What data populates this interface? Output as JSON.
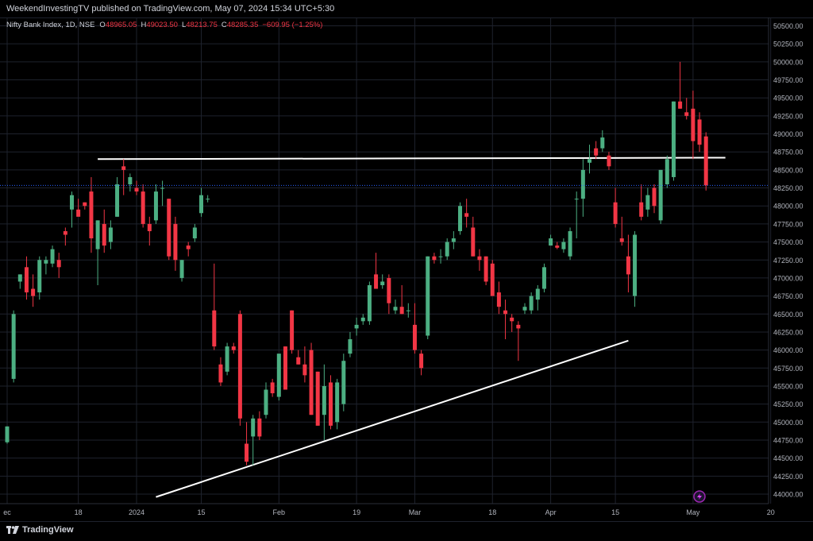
{
  "header": {
    "published": "WeekendInvestingTV published on TradingView.com, May 07, 2024 15:34 UTC+5:30"
  },
  "legend": {
    "symbol": "Nifty Bank Index, 1D, NSE",
    "o_label": "O",
    "o": "48965.05",
    "h_label": "H",
    "h": "49023.50",
    "l_label": "L",
    "l": "48213.75",
    "c_label": "C",
    "c": "48285.35",
    "change": "−609.95 (−1.25%)"
  },
  "footer": {
    "brand": "TradingView"
  },
  "colors": {
    "up": "#4caf82",
    "down": "#f23645",
    "grid": "#1e222d",
    "axis_text": "#b2b5be",
    "trendline": "#ffffff",
    "price_line": "#2962ff"
  },
  "chart_data": {
    "type": "candlestick",
    "symbol": "Nifty Bank Index",
    "interval": "1D",
    "exchange": "NSE",
    "ylim": [
      43950,
      50750
    ],
    "yticks": [
      44000,
      44250,
      44500,
      44750,
      45000,
      45250,
      45500,
      45750,
      46000,
      46250,
      46500,
      46750,
      47000,
      47250,
      47500,
      47750,
      48000,
      48250,
      48500,
      48750,
      49000,
      49250,
      49500,
      49750,
      50000,
      50250,
      50500
    ],
    "ytick_labels": [
      "44000.00",
      "44250.00",
      "44500.00",
      "44750.00",
      "45000.00",
      "45250.00",
      "45500.00",
      "45750.00",
      "46000.00",
      "46250.00",
      "46500.00",
      "46750.00",
      "47000.00",
      "47250.00",
      "47500.00",
      "47750.00",
      "48000.00",
      "48250.00",
      "48500.00",
      "48750.00",
      "49000.00",
      "49250.00",
      "49500.00",
      "49750.00",
      "50000.00",
      "50250.00",
      "50500.00"
    ],
    "xticks": [
      {
        "label": "ec",
        "index": 0
      },
      {
        "label": "18",
        "index": 11
      },
      {
        "label": "2024",
        "index": 20
      },
      {
        "label": "15",
        "index": 30
      },
      {
        "label": "Feb",
        "index": 42
      },
      {
        "label": "19",
        "index": 54
      },
      {
        "label": "Mar",
        "index": 63
      },
      {
        "label": "18",
        "index": 75
      },
      {
        "label": "Apr",
        "index": 84
      },
      {
        "label": "15",
        "index": 94
      },
      {
        "label": "May",
        "index": 106
      },
      {
        "label": "20",
        "index": 118
      }
    ],
    "candles": [
      {
        "o": 44720,
        "h": 44940,
        "l": 44700,
        "c": 44940
      },
      {
        "o": 45600,
        "h": 46550,
        "l": 45550,
        "c": 46500
      },
      {
        "o": 46950,
        "h": 47050,
        "l": 46850,
        "c": 47050
      },
      {
        "o": 47150,
        "h": 47300,
        "l": 46700,
        "c": 46800
      },
      {
        "o": 46850,
        "h": 47050,
        "l": 46600,
        "c": 46750
      },
      {
        "o": 46800,
        "h": 47300,
        "l": 46700,
        "c": 47250
      },
      {
        "o": 47200,
        "h": 47300,
        "l": 47050,
        "c": 47250
      },
      {
        "o": 47200,
        "h": 47450,
        "l": 47150,
        "c": 47400
      },
      {
        "o": 47250,
        "h": 47350,
        "l": 47000,
        "c": 47150
      },
      {
        "o": 47650,
        "h": 47700,
        "l": 47450,
        "c": 47600
      },
      {
        "o": 47950,
        "h": 48200,
        "l": 47700,
        "c": 48150
      },
      {
        "o": 47950,
        "h": 48100,
        "l": 47900,
        "c": 47850
      },
      {
        "o": 48050,
        "h": 48050,
        "l": 47950,
        "c": 48000
      },
      {
        "o": 48200,
        "h": 48400,
        "l": 47350,
        "c": 47550
      },
      {
        "o": 47400,
        "h": 47800,
        "l": 46900,
        "c": 47800
      },
      {
        "o": 47750,
        "h": 47950,
        "l": 47350,
        "c": 47450
      },
      {
        "o": 47500,
        "h": 47800,
        "l": 47400,
        "c": 47700
      },
      {
        "o": 47850,
        "h": 48400,
        "l": 47850,
        "c": 48300
      },
      {
        "o": 48550,
        "h": 48650,
        "l": 48150,
        "c": 48500
      },
      {
        "o": 48300,
        "h": 48450,
        "l": 48200,
        "c": 48400
      },
      {
        "o": 48250,
        "h": 48350,
        "l": 48150,
        "c": 48200
      },
      {
        "o": 48200,
        "h": 48300,
        "l": 47700,
        "c": 47750
      },
      {
        "o": 47750,
        "h": 47850,
        "l": 47450,
        "c": 47650
      },
      {
        "o": 47800,
        "h": 48300,
        "l": 47750,
        "c": 48200
      },
      {
        "o": 48250,
        "h": 48350,
        "l": 48000,
        "c": 48250
      },
      {
        "o": 48100,
        "h": 48100,
        "l": 47250,
        "c": 47300
      },
      {
        "o": 47750,
        "h": 47850,
        "l": 47100,
        "c": 47250
      },
      {
        "o": 47000,
        "h": 47250,
        "l": 46950,
        "c": 47250
      },
      {
        "o": 47450,
        "h": 47500,
        "l": 47300,
        "c": 47400
      },
      {
        "o": 47550,
        "h": 47750,
        "l": 47500,
        "c": 47700
      },
      {
        "o": 47900,
        "h": 48250,
        "l": 47850,
        "c": 48150
      },
      {
        "o": 48100,
        "h": 48150,
        "l": 48050,
        "c": 48100
      },
      {
        "o": 46550,
        "h": 47200,
        "l": 46000,
        "c": 46050
      },
      {
        "o": 45800,
        "h": 45900,
        "l": 45500,
        "c": 45550
      },
      {
        "o": 45700,
        "h": 46100,
        "l": 45650,
        "c": 46050
      },
      {
        "o": 46050,
        "h": 46100,
        "l": 45950,
        "c": 46000
      },
      {
        "o": 46500,
        "h": 46550,
        "l": 44950,
        "c": 45050
      },
      {
        "o": 44700,
        "h": 45000,
        "l": 44400,
        "c": 44450
      },
      {
        "o": 44800,
        "h": 45100,
        "l": 44400,
        "c": 45050
      },
      {
        "o": 45050,
        "h": 45150,
        "l": 44750,
        "c": 44800
      },
      {
        "o": 45100,
        "h": 45550,
        "l": 45050,
        "c": 45450
      },
      {
        "o": 45550,
        "h": 45600,
        "l": 45350,
        "c": 45400
      },
      {
        "o": 45350,
        "h": 45900,
        "l": 45300,
        "c": 45950
      },
      {
        "o": 46050,
        "h": 46050,
        "l": 45450,
        "c": 45450
      },
      {
        "o": 46550,
        "h": 46550,
        "l": 45950,
        "c": 46000
      },
      {
        "o": 45900,
        "h": 46000,
        "l": 45800,
        "c": 45800
      },
      {
        "o": 45800,
        "h": 46050,
        "l": 45550,
        "c": 45650
      },
      {
        "o": 46000,
        "h": 46100,
        "l": 45100,
        "c": 45100
      },
      {
        "o": 45700,
        "h": 45700,
        "l": 44950,
        "c": 44950
      },
      {
        "o": 45100,
        "h": 45800,
        "l": 44750,
        "c": 45500
      },
      {
        "o": 45550,
        "h": 45650,
        "l": 44900,
        "c": 44950
      },
      {
        "o": 45000,
        "h": 45600,
        "l": 44900,
        "c": 45550
      },
      {
        "o": 45250,
        "h": 45950,
        "l": 45150,
        "c": 45850
      },
      {
        "o": 45950,
        "h": 46250,
        "l": 45900,
        "c": 46150
      },
      {
        "o": 46300,
        "h": 46450,
        "l": 46200,
        "c": 46350
      },
      {
        "o": 46400,
        "h": 46500,
        "l": 46350,
        "c": 46450
      },
      {
        "o": 46400,
        "h": 46950,
        "l": 46350,
        "c": 46900
      },
      {
        "o": 47050,
        "h": 47350,
        "l": 46850,
        "c": 46850
      },
      {
        "o": 46900,
        "h": 47050,
        "l": 46850,
        "c": 46950
      },
      {
        "o": 47000,
        "h": 47050,
        "l": 46500,
        "c": 46650
      },
      {
        "o": 46550,
        "h": 46700,
        "l": 46500,
        "c": 46600
      },
      {
        "o": 46600,
        "h": 46900,
        "l": 46500,
        "c": 46500
      },
      {
        "o": 46550,
        "h": 46650,
        "l": 46450,
        "c": 46550
      },
      {
        "o": 46350,
        "h": 46650,
        "l": 45950,
        "c": 46000
      },
      {
        "o": 45950,
        "h": 46000,
        "l": 45650,
        "c": 45750
      },
      {
        "o": 46200,
        "h": 47300,
        "l": 46150,
        "c": 47300
      },
      {
        "o": 47300,
        "h": 47350,
        "l": 47200,
        "c": 47250
      },
      {
        "o": 47300,
        "h": 47400,
        "l": 47200,
        "c": 47300
      },
      {
        "o": 47300,
        "h": 47550,
        "l": 47250,
        "c": 47500
      },
      {
        "o": 47500,
        "h": 47650,
        "l": 47400,
        "c": 47550
      },
      {
        "o": 47650,
        "h": 48050,
        "l": 47600,
        "c": 48000
      },
      {
        "o": 47900,
        "h": 48100,
        "l": 47700,
        "c": 47850
      },
      {
        "o": 47700,
        "h": 47850,
        "l": 47300,
        "c": 47300
      },
      {
        "o": 47300,
        "h": 47400,
        "l": 47100,
        "c": 47250
      },
      {
        "o": 47300,
        "h": 47300,
        "l": 46900,
        "c": 46950
      },
      {
        "o": 47200,
        "h": 47250,
        "l": 46750,
        "c": 46750
      },
      {
        "o": 46800,
        "h": 46950,
        "l": 46500,
        "c": 46600
      },
      {
        "o": 46550,
        "h": 46700,
        "l": 46150,
        "c": 46500
      },
      {
        "o": 46450,
        "h": 46500,
        "l": 46250,
        "c": 46400
      },
      {
        "o": 46350,
        "h": 46400,
        "l": 45850,
        "c": 46300
      },
      {
        "o": 46550,
        "h": 46650,
        "l": 46500,
        "c": 46600
      },
      {
        "o": 46550,
        "h": 46800,
        "l": 46500,
        "c": 46750
      },
      {
        "o": 46700,
        "h": 46900,
        "l": 46550,
        "c": 46850
      },
      {
        "o": 46850,
        "h": 47200,
        "l": 46800,
        "c": 47150
      },
      {
        "o": 47450,
        "h": 47600,
        "l": 47450,
        "c": 47550
      },
      {
        "o": 47450,
        "h": 47500,
        "l": 47400,
        "c": 47420
      },
      {
        "o": 47400,
        "h": 47550,
        "l": 47350,
        "c": 47500
      },
      {
        "o": 47300,
        "h": 47700,
        "l": 47250,
        "c": 47650
      },
      {
        "o": 48100,
        "h": 48200,
        "l": 47550,
        "c": 48100
      },
      {
        "o": 48100,
        "h": 48650,
        "l": 47850,
        "c": 48500
      },
      {
        "o": 48600,
        "h": 48850,
        "l": 48450,
        "c": 48650
      },
      {
        "o": 48800,
        "h": 48900,
        "l": 48650,
        "c": 48700
      },
      {
        "o": 48800,
        "h": 49050,
        "l": 48750,
        "c": 48950
      },
      {
        "o": 48700,
        "h": 48750,
        "l": 48500,
        "c": 48550
      },
      {
        "o": 48050,
        "h": 48250,
        "l": 47700,
        "c": 47750
      },
      {
        "o": 47550,
        "h": 47850,
        "l": 47450,
        "c": 47500
      },
      {
        "o": 47300,
        "h": 47600,
        "l": 46800,
        "c": 47050
      },
      {
        "o": 46750,
        "h": 47650,
        "l": 46600,
        "c": 47600
      },
      {
        "o": 48050,
        "h": 48300,
        "l": 47800,
        "c": 47850
      },
      {
        "o": 47950,
        "h": 48250,
        "l": 47850,
        "c": 48150
      },
      {
        "o": 48250,
        "h": 48300,
        "l": 47900,
        "c": 48000
      },
      {
        "o": 47800,
        "h": 48500,
        "l": 47750,
        "c": 48500
      },
      {
        "o": 48300,
        "h": 48700,
        "l": 48250,
        "c": 48650
      },
      {
        "o": 48400,
        "h": 49450,
        "l": 48350,
        "c": 49450
      },
      {
        "o": 49450,
        "h": 50000,
        "l": 49350,
        "c": 49350
      },
      {
        "o": 49300,
        "h": 49500,
        "l": 49200,
        "c": 49250
      },
      {
        "o": 49350,
        "h": 49600,
        "l": 48650,
        "c": 48900
      },
      {
        "o": 49200,
        "h": 49300,
        "l": 48750,
        "c": 48850
      },
      {
        "o": 48965.05,
        "h": 49023.5,
        "l": 48213.75,
        "c": 48285.35
      }
    ],
    "last_price": 48285.35,
    "trendlines": [
      {
        "from": {
          "index": 14,
          "price": 48650
        },
        "to": {
          "index": 111,
          "price": 48670
        }
      },
      {
        "from": {
          "index": 23,
          "price": 43960
        },
        "to": {
          "index": 96,
          "price": 46130
        }
      }
    ]
  }
}
